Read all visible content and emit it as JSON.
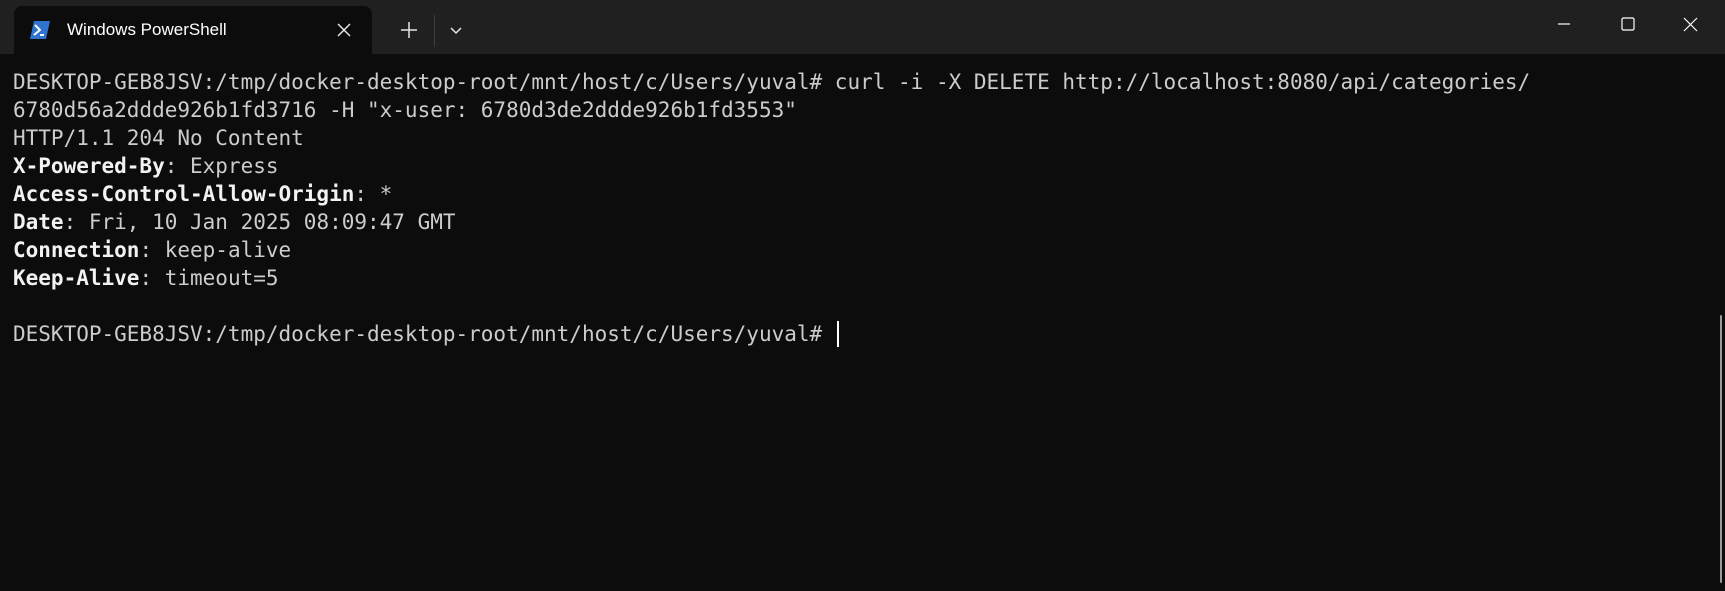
{
  "window": {
    "tab_title": "Windows PowerShell",
    "tab_icon": "powershell-icon",
    "new_tab_icon": "plus-icon",
    "dropdown_icon": "chevron-down-icon",
    "minimize_icon": "minimize-icon",
    "maximize_icon": "maximize-icon",
    "close_icon": "close-icon"
  },
  "terminal": {
    "command_line_1": "DESKTOP-GEB8JSV:/tmp/docker-desktop-root/mnt/host/c/Users/yuval# curl -i -X DELETE http://localhost:8080/api/categories/",
    "command_line_2": "6780d56a2ddde926b1fd3716 -H \"x-user: 6780d3de2ddde926b1fd3553\"",
    "status_line": "HTTP/1.1 204 No Content",
    "headers": [
      {
        "name": "X-Powered-By",
        "value": ": Express"
      },
      {
        "name": "Access-Control-Allow-Origin",
        "value": ": *"
      },
      {
        "name": "Date",
        "value": ": Fri, 10 Jan 2025 08:09:47 GMT"
      },
      {
        "name": "Connection",
        "value": ": keep-alive"
      },
      {
        "name": "Keep-Alive",
        "value": ": timeout=5"
      }
    ],
    "prompt": "DESKTOP-GEB8JSV:/tmp/docker-desktop-root/mnt/host/c/Users/yuval# "
  },
  "colors": {
    "background": "#0c0c0c",
    "titlebar": "#202020",
    "text": "#cccccc",
    "header_name": "#f2f2f2",
    "powershell_blue": "#2f74d0"
  }
}
